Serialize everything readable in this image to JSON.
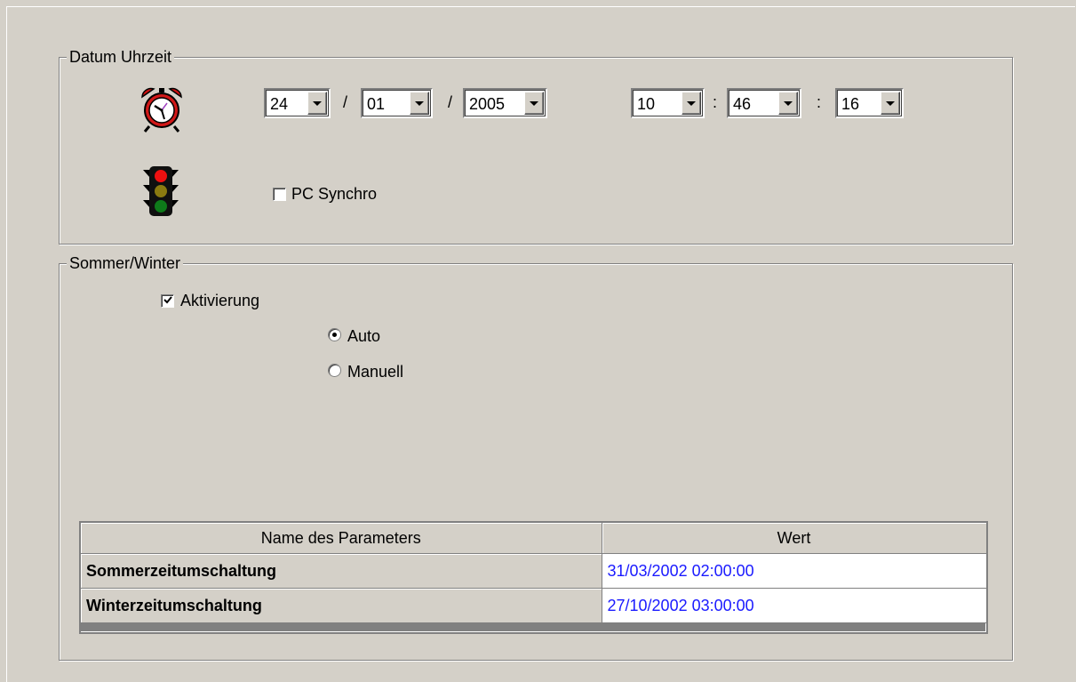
{
  "datetime_group": {
    "title": "Datum Uhrzeit",
    "day": "24",
    "month": "01",
    "year": "2005",
    "hour": "10",
    "minute": "46",
    "second": "16",
    "date_separator": "/",
    "time_separator": ":",
    "pc_synchro": {
      "label": "PC Synchro",
      "checked": false
    }
  },
  "summer_winter_group": {
    "title": "Sommer/Winter",
    "activation": {
      "label": "Aktivierung",
      "checked": true
    },
    "mode_auto": {
      "label": "Auto",
      "selected": true
    },
    "mode_manual": {
      "label": "Manuell",
      "selected": false
    }
  },
  "param_table": {
    "columns": [
      "Name des Parameters",
      "Wert"
    ],
    "rows": [
      {
        "name": "Sommerzeitumschaltung",
        "value": "31/03/2002 02:00:00"
      },
      {
        "name": "Winterzeitumschaltung",
        "value": "27/10/2002 03:00:00"
      }
    ]
  },
  "colors": {
    "background": "#d4d0c8",
    "value_text": "#1a1aff"
  },
  "icons": {
    "clock": "alarm-clock-icon",
    "traffic_light": "traffic-light-icon"
  }
}
